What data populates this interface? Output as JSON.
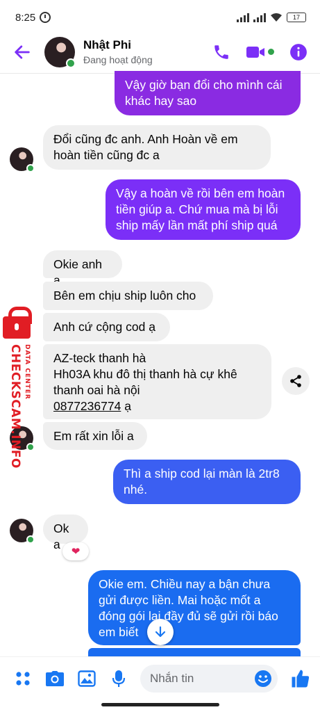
{
  "status_bar": {
    "time": "8:25",
    "battery": "17"
  },
  "header": {
    "name": "Nhật Phi",
    "status": "Đang hoạt động"
  },
  "colors": {
    "accent": "#7b2ff7",
    "messenger_blue": "#1877f2",
    "online": "#31a24c",
    "incoming_bg": "#efefef",
    "watermark": "#e11d24"
  },
  "icons": {
    "back": "arrow-left-icon",
    "call": "phone-icon",
    "video": "video-camera-icon",
    "info": "info-icon"
  },
  "messages": [
    {
      "from": "me",
      "text": "Vậy giờ bạn đổi cho mình cái khác hay sao",
      "color": "#8a2be2"
    },
    {
      "from": "them",
      "text": "Đổi cũng đc anh. Anh Hoàn về em hoàn tiền cũng đc a"
    },
    {
      "from": "me",
      "text": "Vậy a hoàn về rồi bên em hoàn tiền giúp a. Chứ mua mà bị lỗi ship mấy lần mất phí ship quá",
      "color": "#7b2ff7"
    },
    {
      "from": "them",
      "text": "Okie anh ạ"
    },
    {
      "from": "them",
      "text": "Bên em chịu ship luôn cho"
    },
    {
      "from": "them",
      "text": "Anh cứ cộng cod ạ"
    },
    {
      "from": "them",
      "lines": [
        "AZ-teck thanh hà",
        "Hh03A khu đô thị thanh hà cự khê",
        "thanh oai hà nội"
      ],
      "phone": "0877236774",
      "suffix": " ạ"
    },
    {
      "from": "them",
      "text": "Em rất xin lỗi a"
    },
    {
      "from": "me",
      "text": "Thì a ship cod lại màn là 2tr8 nhé.",
      "color": "#3b5ff2"
    },
    {
      "from": "them",
      "text": "Ok a",
      "reaction": "❤"
    },
    {
      "from": "me",
      "text": "Okie em. Chiều nay a bận chưa gửi được liền. Mai hoặc mốt a đóng gói lại đầy đủ sẽ gửi rồi báo em biết",
      "color": "#1a6cf0"
    }
  ],
  "watermark": {
    "title": "CHECKSCAM.INFO",
    "subtitle": "DATA CENTER"
  },
  "composer": {
    "placeholder": "Nhắn tin"
  }
}
